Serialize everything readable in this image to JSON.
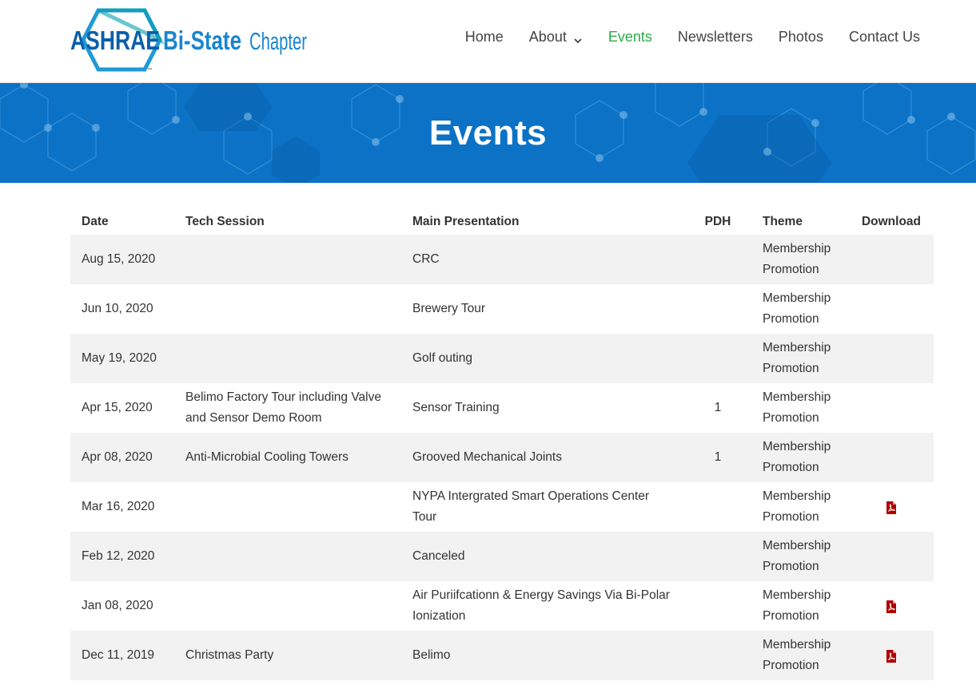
{
  "logo": {
    "acronym": "ASHRAE",
    "chapter_name": "Bi-State",
    "chapter_word": "Chapter",
    "mark": "™"
  },
  "nav": {
    "items": [
      {
        "label": "Home"
      },
      {
        "label": "About",
        "has_dropdown": true
      },
      {
        "label": "Events",
        "active": true
      },
      {
        "label": "Newsletters"
      },
      {
        "label": "Photos"
      },
      {
        "label": "Contact Us"
      }
    ]
  },
  "hero": {
    "title": "Events"
  },
  "colors": {
    "brand_blue": "#0b72c6",
    "active_nav": "#2eaa44",
    "pdf_red": "#b00000",
    "row_stripe": "#f2f2f2"
  },
  "table": {
    "headers": {
      "date": "Date",
      "tech": "Tech Session",
      "main": "Main Presentation",
      "pdh": "PDH",
      "theme": "Theme",
      "download": "Download"
    },
    "rows": [
      {
        "date": "Aug 15, 2020",
        "tech": "",
        "main": "CRC",
        "pdh": "",
        "theme": "Membership Promotion",
        "download": false
      },
      {
        "date": "Jun 10, 2020",
        "tech": "",
        "main": "Brewery Tour",
        "pdh": "",
        "theme": "Membership Promotion",
        "download": false
      },
      {
        "date": "May 19, 2020",
        "tech": "",
        "main": "Golf outing",
        "pdh": "",
        "theme": "Membership Promotion",
        "download": false
      },
      {
        "date": "Apr 15, 2020",
        "tech": "Belimo Factory Tour including Valve and Sensor Demo Room",
        "main": "Sensor Training",
        "pdh": "1",
        "theme": "Membership Promotion",
        "download": false
      },
      {
        "date": "Apr 08, 2020",
        "tech": "Anti-Microbial Cooling Towers",
        "main": "Grooved Mechanical Joints",
        "pdh": "1",
        "theme": "Membership Promotion",
        "download": false
      },
      {
        "date": "Mar 16, 2020",
        "tech": "",
        "main": "NYPA Intergrated Smart Operations Center Tour",
        "pdh": "",
        "theme": "Membership Promotion",
        "download": true
      },
      {
        "date": "Feb 12, 2020",
        "tech": "",
        "main": "Canceled",
        "pdh": "",
        "theme": "Membership Promotion",
        "download": false
      },
      {
        "date": "Jan 08, 2020",
        "tech": "",
        "main": "Air Puriifcationn & Energy Savings Via Bi-Polar Ionization",
        "pdh": "",
        "theme": "Membership Promotion",
        "download": true
      },
      {
        "date": "Dec 11, 2019",
        "tech": "Christmas Party",
        "main": "Belimo",
        "pdh": "",
        "theme": "Membership Promotion",
        "download": true
      }
    ]
  }
}
